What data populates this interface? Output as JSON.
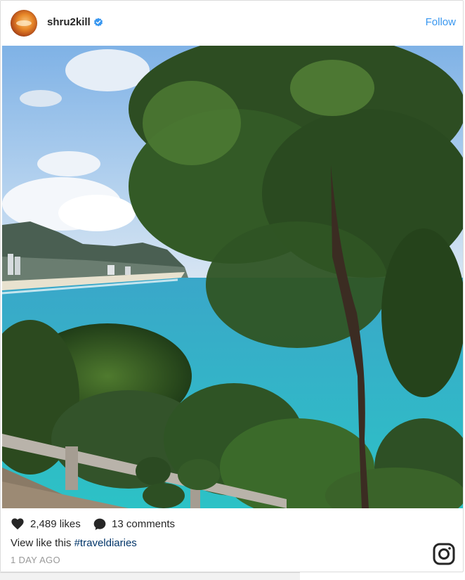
{
  "post": {
    "username": "shru2kill",
    "follow_label": "Follow",
    "likes": "2,489 likes",
    "comments": "13 comments",
    "caption_text": "View like this ",
    "caption_hashtag": "#traveldiaries",
    "time": "1 DAY AGO"
  },
  "icons": {
    "verified": "verified-badge-icon",
    "heart": "heart-icon",
    "comment": "comment-bubble-icon",
    "instagram": "instagram-logo-icon"
  },
  "colors": {
    "follow": "#3897f0",
    "hashtag": "#003569",
    "time": "#999999"
  }
}
